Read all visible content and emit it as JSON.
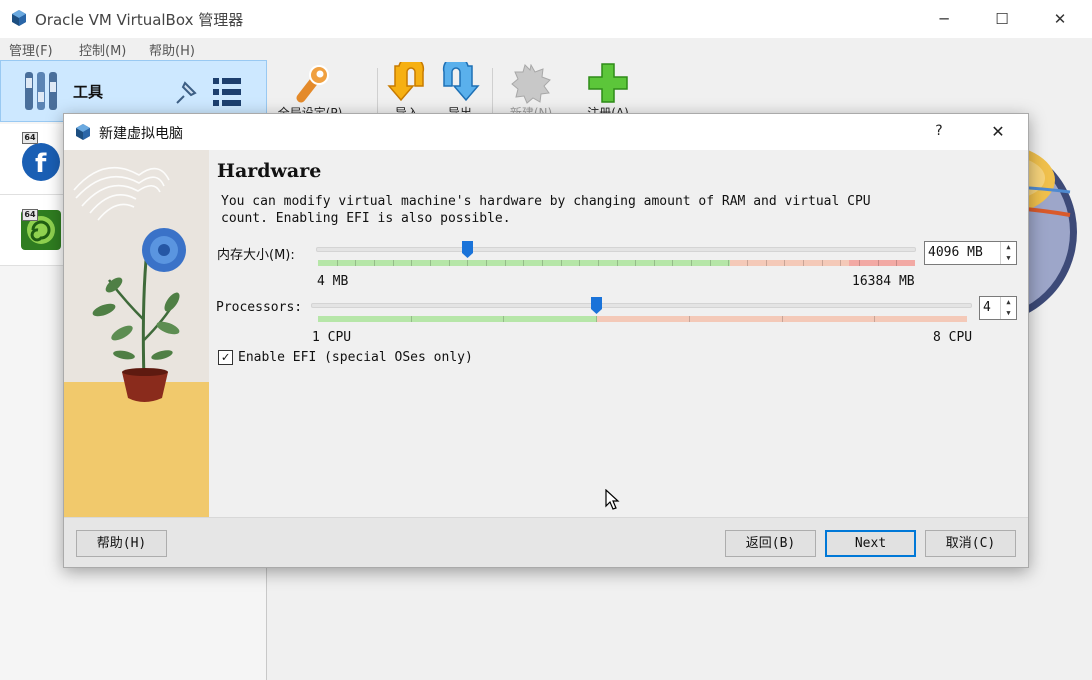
{
  "window": {
    "title": "Oracle VM VirtualBox 管理器",
    "minimize_glyph": "─",
    "maximize_glyph": "☐",
    "close_glyph": "✕"
  },
  "menu": [
    "管理(F)",
    "控制(M)",
    "帮助(H)"
  ],
  "sidebar": {
    "tools_label": "工具",
    "vms": [
      {
        "badge": "64",
        "icon": "fedora-logo-icon"
      },
      {
        "badge": "64",
        "icon": "os-swirl-logo-icon"
      }
    ]
  },
  "toolbar": {
    "buttons": [
      {
        "label": "全局设定(P)",
        "icon": "wrench-icon"
      },
      {
        "label": "导入",
        "icon": "import-arrow-icon"
      },
      {
        "label": "导出",
        "icon": "export-arrow-icon"
      },
      {
        "label": "新建(N)",
        "icon": "new-gear-icon"
      },
      {
        "label": "注册(A)",
        "icon": "add-plus-icon"
      }
    ]
  },
  "dialog": {
    "title": "新建虚拟电脑",
    "help_glyph": "?",
    "close_glyph": "✕",
    "heading": "Hardware",
    "description": "You can modify virtual machine's hardware by changing amount of RAM and virtual CPU count. Enabling EFI is also possible.",
    "memory": {
      "label": "内存大小(M):",
      "value": 4096,
      "value_text": "4096 MB",
      "min_label": "4 MB",
      "max_label": "16384 MB",
      "min": 4,
      "max": 16384
    },
    "processors": {
      "label": "Processors:",
      "value": 4,
      "value_text": "4",
      "min_label": "1 CPU",
      "max_label": "8 CPU",
      "min": 1,
      "max": 8
    },
    "efi": {
      "checked": true,
      "check_glyph": "✓",
      "label": "Enable EFI (special OSes only)"
    },
    "buttons": {
      "help": "帮助(H)",
      "back": "返回(B)",
      "next": "Next",
      "cancel": "取消(C)"
    }
  },
  "colors": {
    "selection": "#cde8ff",
    "slider_green": "#b6e6a8",
    "slider_orange": "#f4c9b8",
    "slider_red": "#f2a9a4",
    "slider_handle": "#1a73d9",
    "default_button_border": "#0078d7"
  }
}
